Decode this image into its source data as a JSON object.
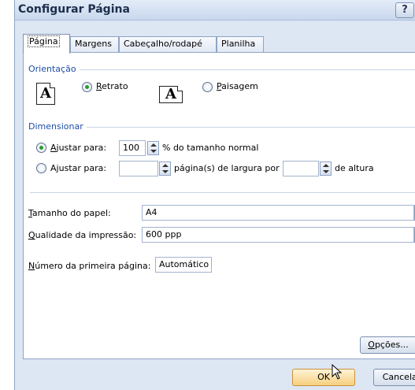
{
  "window": {
    "title": "Configurar Página",
    "help_label": "?"
  },
  "tabs": [
    {
      "label": "Página",
      "active": true
    },
    {
      "label": "Margens",
      "active": false
    },
    {
      "label": "Cabeçalho/rodapé",
      "active": false
    },
    {
      "label": "Planilha",
      "active": false
    }
  ],
  "orientation": {
    "label": "Orientação",
    "portrait_icon_letter": "A",
    "landscape_icon_letter": "A",
    "portrait": {
      "label_u": "R",
      "label_rest": "etrato",
      "checked": true
    },
    "landscape": {
      "label_u": "P",
      "label_rest": "aisagem",
      "checked": false
    }
  },
  "scaling": {
    "label": "Dimensionar",
    "adjust_to": {
      "label_u": "A",
      "label_rest": "justar para:",
      "checked": true,
      "value": "100",
      "suffix": "% do tamanho normal"
    },
    "fit_to": {
      "label_pre": "A",
      "label_u": "j",
      "label_rest": "ustar para:",
      "checked": false,
      "wide_value": "",
      "wide_suffix": "página(s) de largura por",
      "tall_value": "",
      "tall_suffix": "de altura"
    }
  },
  "paper_size": {
    "label_u": "T",
    "label_rest": "amanho do papel:",
    "value": "A4"
  },
  "print_quality": {
    "label_u": "Q",
    "label_rest": "ualidade da impressão:",
    "value": "600 ppp"
  },
  "first_page": {
    "label_u": "N",
    "label_rest": "úmero da primeira página:",
    "value": "Automático"
  },
  "buttons": {
    "options": {
      "label_u": "O",
      "label_rest": "pções..."
    },
    "ok": "OK",
    "cancel": "Cancelar"
  }
}
